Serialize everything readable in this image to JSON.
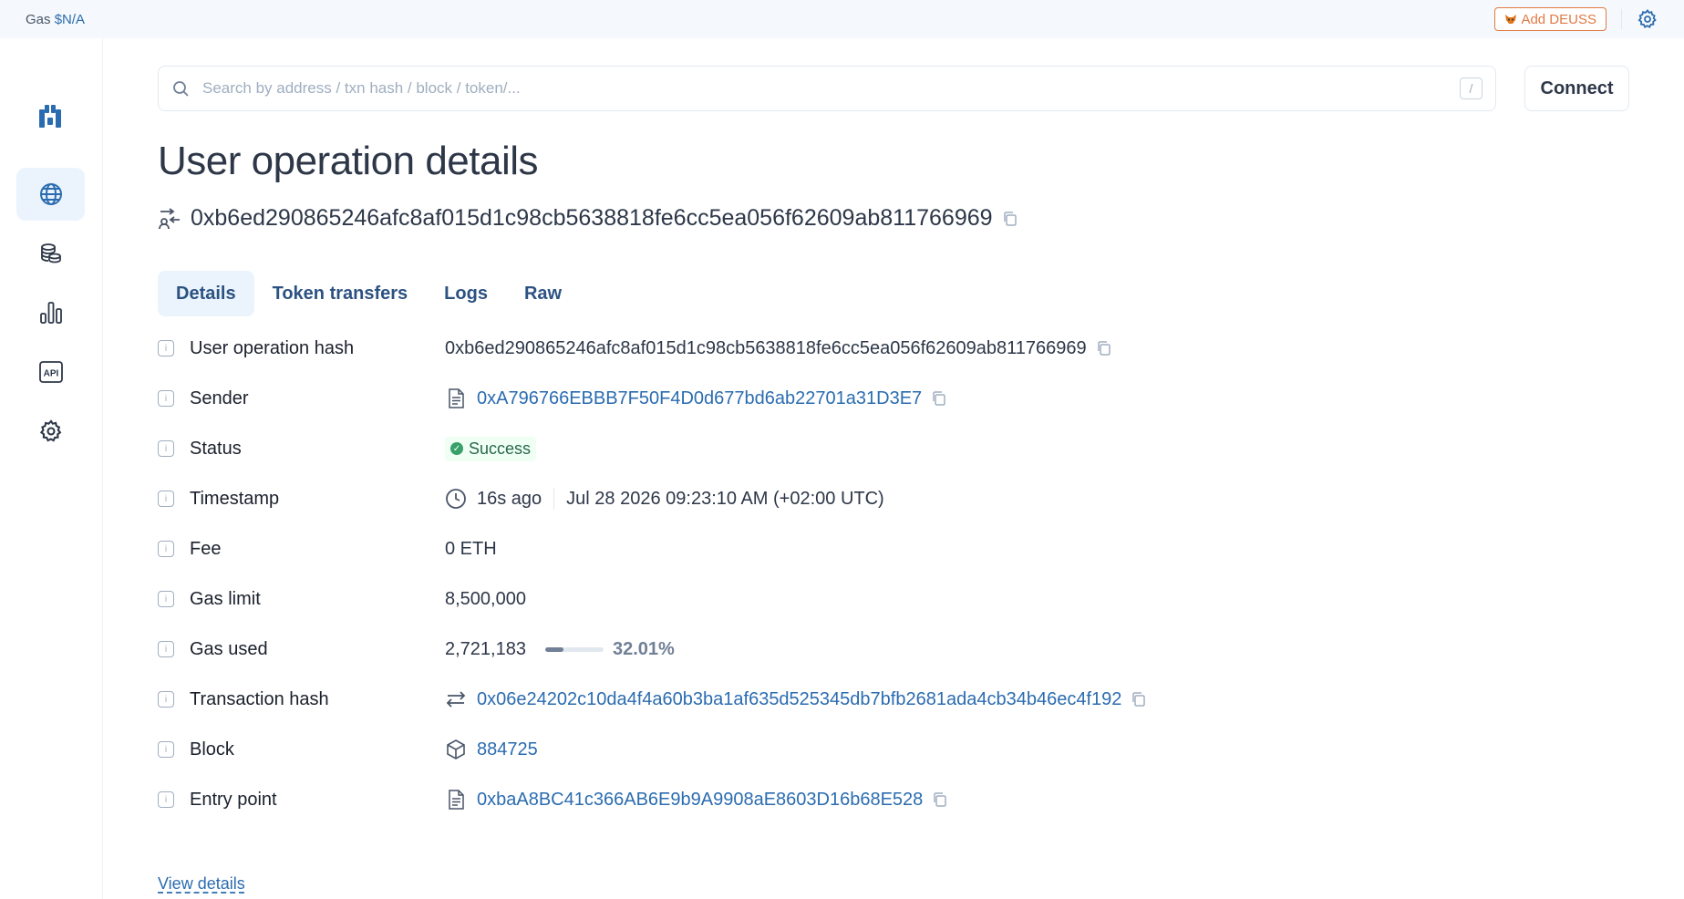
{
  "topbar": {
    "gas_label": "Gas",
    "gas_value": "$N/A",
    "add_token_label": "Add DEUSS"
  },
  "search": {
    "placeholder": "Search by address / txn hash / block / token/...",
    "shortcut": "/"
  },
  "header": {
    "connect_label": "Connect"
  },
  "page": {
    "title": "User operation details",
    "hash": "0xb6ed290865246afc8af015d1c98cb5638818fe6cc5ea056f62609ab811766969"
  },
  "tabs": [
    {
      "label": "Details",
      "active": true
    },
    {
      "label": "Token transfers",
      "active": false
    },
    {
      "label": "Logs",
      "active": false
    },
    {
      "label": "Raw",
      "active": false
    }
  ],
  "details": {
    "user_op_hash": {
      "label": "User operation hash",
      "value": "0xb6ed290865246afc8af015d1c98cb5638818fe6cc5ea056f62609ab811766969"
    },
    "sender": {
      "label": "Sender",
      "value": "0xA796766EBBB7F50F4D0d677bd6ab22701a31D3E7"
    },
    "status": {
      "label": "Status",
      "value": "Success"
    },
    "timestamp": {
      "label": "Timestamp",
      "relative": "16s ago",
      "absolute": "Jul 28 2026 09:23:10 AM (+02:00 UTC)"
    },
    "fee": {
      "label": "Fee",
      "value": "0 ETH"
    },
    "gas_limit": {
      "label": "Gas limit",
      "value": "8,500,000"
    },
    "gas_used": {
      "label": "Gas used",
      "value": "2,721,183",
      "percent_text": "32.01%",
      "fraction": 0.3201
    },
    "tx_hash": {
      "label": "Transaction hash",
      "value": "0x06e24202c10da4f4a60b3ba1af635d525345db7bfb2681ada4cb34b46ec4f192"
    },
    "block": {
      "label": "Block",
      "value": "884725"
    },
    "entry_point": {
      "label": "Entry point",
      "value": "0xbaA8BC41c366AB6E9b9A9908aE8603D16b68E528"
    }
  },
  "footer": {
    "view_details": "View details"
  },
  "colors": {
    "accent": "#2b6cb0",
    "success": "#38a169",
    "warning": "#e07a45"
  },
  "icons": {
    "logo": "blockscout-logo-icon",
    "nav": [
      "globe-icon",
      "coins-icon",
      "bar-chart-icon",
      "api-icon",
      "gear-icon"
    ]
  }
}
